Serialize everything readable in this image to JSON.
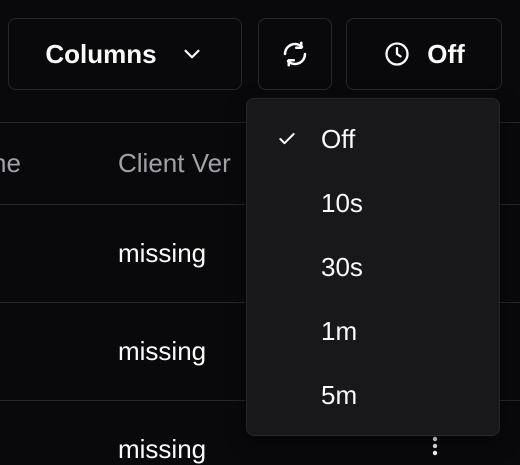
{
  "toolbar": {
    "columns_label": "Columns",
    "columns_icon": "chevron-down-icon",
    "refresh_icon": "refresh-icon",
    "auto_refresh_label": "Off",
    "auto_refresh_icon": "clock-icon"
  },
  "table": {
    "headers": [
      "ne",
      "Client Ver"
    ],
    "rows": [
      {
        "client_version": "missing"
      },
      {
        "client_version": "missing"
      },
      {
        "client_version": "missing"
      }
    ]
  },
  "refresh_menu": {
    "selected": "Off",
    "items": [
      "Off",
      "10s",
      "30s",
      "1m",
      "5m"
    ]
  },
  "colors": {
    "background": "#09090b",
    "border": "#27272a",
    "menu_background": "#18181b",
    "muted_text": "#a1a1aa",
    "text": "#fafafa"
  }
}
